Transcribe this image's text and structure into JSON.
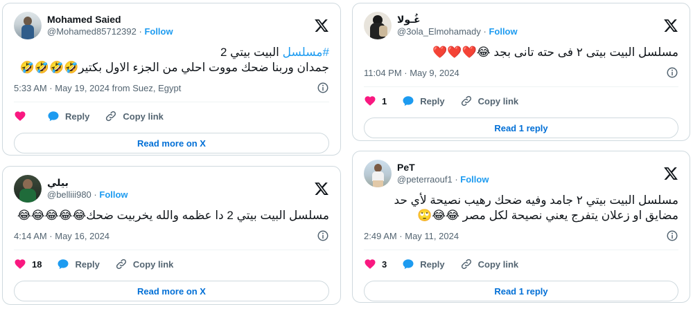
{
  "cards": [
    {
      "name": "Mohamed Saied",
      "handle": "@Mohamed85712392",
      "follow": "Follow",
      "hashtag": "#مسلسل",
      "text_rest": " البيت بيتي 2",
      "text_line2": "جمدان وربنا ضحك مووت احلي من الجزء الاول بكتير🤣🤣🤣🤣",
      "meta": "5:33 AM · May 19, 2024 from Suez, Egypt",
      "like_count": "",
      "reply_label": "Reply",
      "copy_label": "Copy link",
      "cta": "Read more on X"
    },
    {
      "name": "غُـولا",
      "handle": "@3ola_Elmohamady",
      "follow": "Follow",
      "text_line1": "مسلسل البيت بيتى ٢ فى حته تانى بجد 😂❤️❤️❤️",
      "meta": "11:04 PM · May 9, 2024",
      "like_count": "1",
      "reply_label": "Reply",
      "copy_label": "Copy link",
      "cta": "Read 1 reply"
    },
    {
      "name": "بيلي",
      "handle": "@belliii980",
      "follow": "Follow",
      "text_line1": "مسلسل البيت بيتي 2 دا عظمه والله يخربيت ضحك😂😂😂😂😂",
      "meta": "4:14 AM · May 16, 2024",
      "like_count": "18",
      "reply_label": "Reply",
      "copy_label": "Copy link",
      "cta": "Read more on X"
    },
    {
      "name": "PeT",
      "handle": "@peterraouf1",
      "follow": "Follow",
      "text_line1": "مسلسل البيت بيتي ٢ جامد وفيه ضحك رهيب نصيحة لأي حد",
      "text_line2": "مضايق او زعلان يتفرج يعني نصيحة لكل مصر 😂😂🙄",
      "meta": "2:49 AM · May 11, 2024",
      "like_count": "3",
      "reply_label": "Reply",
      "copy_label": "Copy link",
      "cta": "Read 1 reply"
    }
  ],
  "colors": {
    "like": "#f91880",
    "reply": "#1d9bf0",
    "link": "#1d9bf0",
    "cta_text": "#006fd6",
    "muted": "#536471",
    "border": "#cfd9de"
  },
  "icons": [
    "x-logo-icon",
    "info-icon",
    "heart-icon",
    "reply-bubble-icon",
    "link-icon"
  ]
}
